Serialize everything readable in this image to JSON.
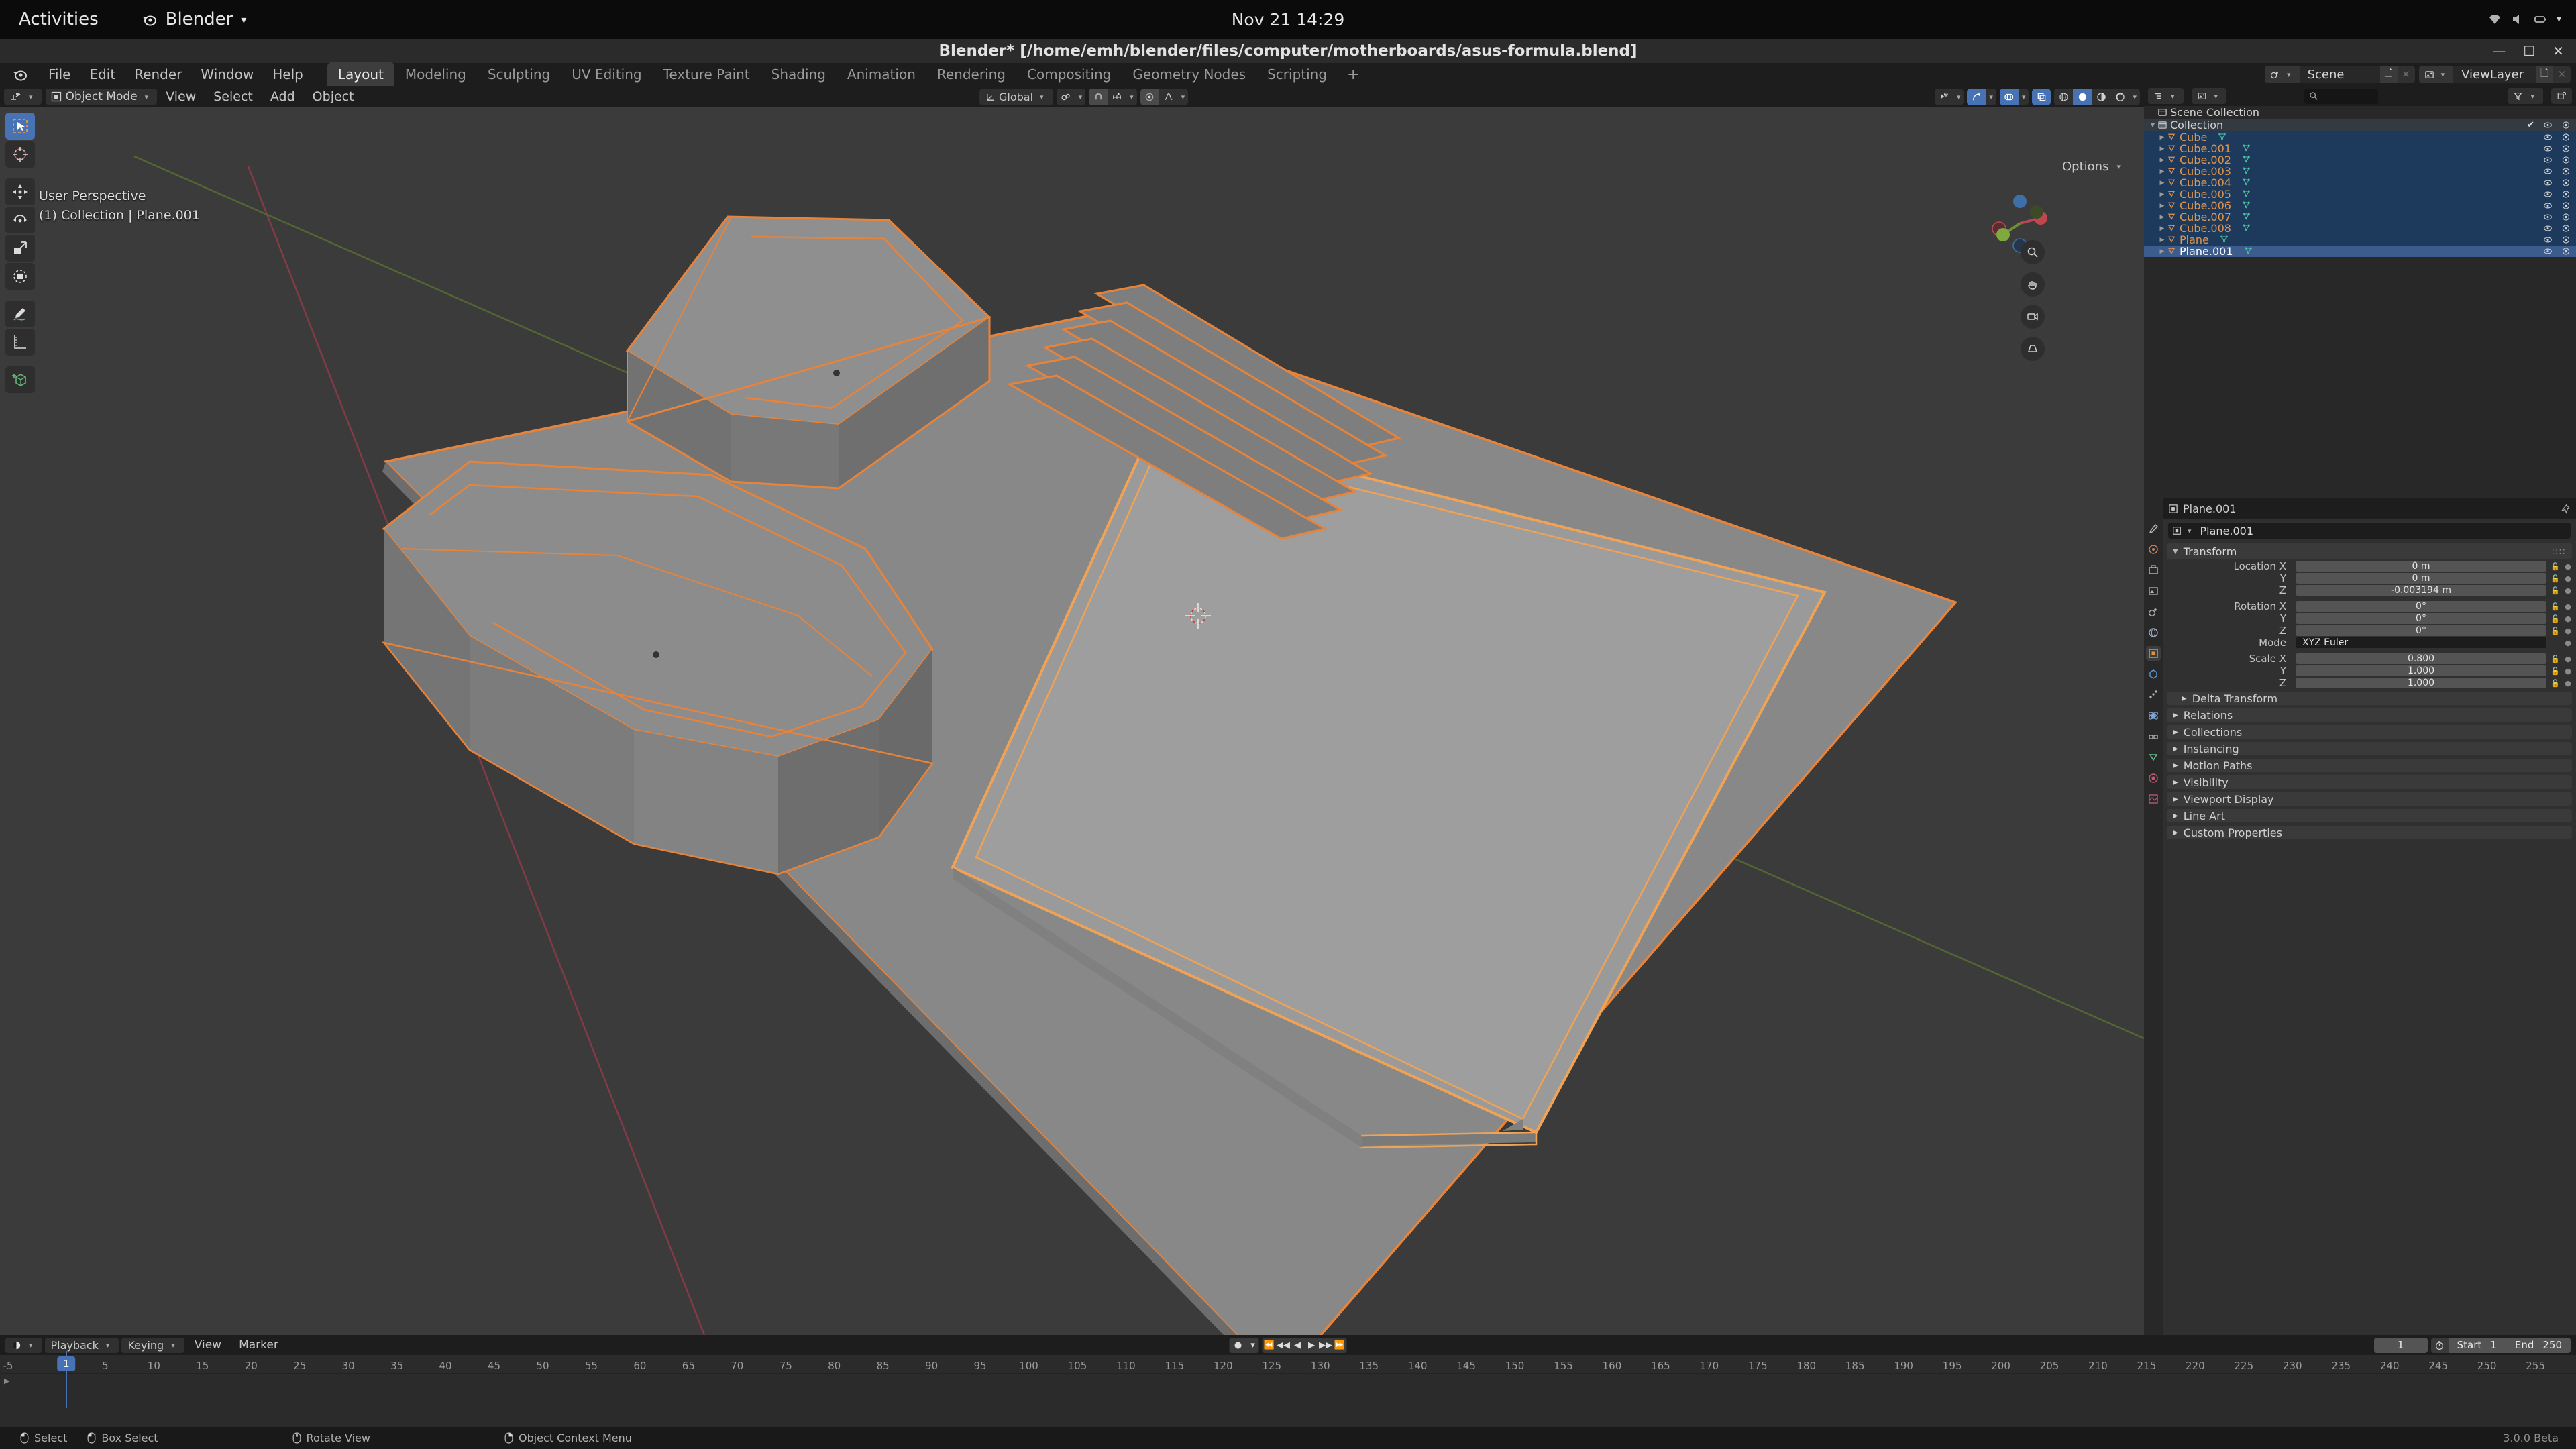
{
  "desktop": {
    "activities": "Activities",
    "app_name": "Blender",
    "clock": "Nov 21  14:29"
  },
  "window": {
    "title": "Blender* [/home/emh/blender/files/computer/motherboards/asus-formula.blend]"
  },
  "topbar": {
    "menus": [
      "File",
      "Edit",
      "Render",
      "Window",
      "Help"
    ],
    "workspaces": [
      {
        "label": "Layout",
        "active": true
      },
      {
        "label": "Modeling",
        "active": false
      },
      {
        "label": "Sculpting",
        "active": false
      },
      {
        "label": "UV Editing",
        "active": false
      },
      {
        "label": "Texture Paint",
        "active": false
      },
      {
        "label": "Shading",
        "active": false
      },
      {
        "label": "Animation",
        "active": false
      },
      {
        "label": "Rendering",
        "active": false
      },
      {
        "label": "Compositing",
        "active": false
      },
      {
        "label": "Geometry Nodes",
        "active": false
      },
      {
        "label": "Scripting",
        "active": false
      }
    ],
    "add_workspace": "+",
    "scene_name": "Scene",
    "viewlayer_name": "ViewLayer"
  },
  "viewport": {
    "mode": "Object Mode",
    "menus": [
      "View",
      "Select",
      "Add",
      "Object"
    ],
    "transform_orientation": "Global",
    "options_label": "Options",
    "overlay_line1": "User Perspective",
    "overlay_line2": "(1) Collection | Plane.001"
  },
  "outliner": {
    "scene_collection": "Scene Collection",
    "collection": "Collection",
    "items": [
      {
        "name": "Cube",
        "selected": true,
        "active": false
      },
      {
        "name": "Cube.001",
        "selected": true,
        "active": false
      },
      {
        "name": "Cube.002",
        "selected": true,
        "active": false
      },
      {
        "name": "Cube.003",
        "selected": true,
        "active": false
      },
      {
        "name": "Cube.004",
        "selected": true,
        "active": false
      },
      {
        "name": "Cube.005",
        "selected": true,
        "active": false
      },
      {
        "name": "Cube.006",
        "selected": true,
        "active": false
      },
      {
        "name": "Cube.007",
        "selected": true,
        "active": false
      },
      {
        "name": "Cube.008",
        "selected": true,
        "active": false
      },
      {
        "name": "Plane",
        "selected": true,
        "active": false
      },
      {
        "name": "Plane.001",
        "selected": true,
        "active": true
      }
    ]
  },
  "properties": {
    "breadcrumb_object": "Plane.001",
    "object_name": "Plane.001",
    "transform_panel": "Transform",
    "fields": [
      {
        "label": "Location X",
        "value": "0 m"
      },
      {
        "label": "Y",
        "value": "0 m"
      },
      {
        "label": "Z",
        "value": "-0.003194 m"
      }
    ],
    "rotation_fields": [
      {
        "label": "Rotation X",
        "value": "0°"
      },
      {
        "label": "Y",
        "value": "0°"
      },
      {
        "label": "Z",
        "value": "0°"
      }
    ],
    "mode_label": "Mode",
    "mode_value": "XYZ Euler",
    "scale_fields": [
      {
        "label": "Scale X",
        "value": "0.800"
      },
      {
        "label": "Y",
        "value": "1.000"
      },
      {
        "label": "Z",
        "value": "1.000"
      }
    ],
    "delta_transform": "Delta Transform",
    "panels": [
      "Relations",
      "Collections",
      "Instancing",
      "Motion Paths",
      "Visibility",
      "Viewport Display",
      "Line Art",
      "Custom Properties"
    ]
  },
  "timeline": {
    "playback": "Playback",
    "keying": "Keying",
    "view": "View",
    "marker": "Marker",
    "current_frame": "1",
    "start_label": "Start",
    "start_value": "1",
    "end_label": "End",
    "end_value": "250",
    "ruler_ticks": [
      "-5",
      "5",
      "10",
      "15",
      "20",
      "25",
      "30",
      "35",
      "40",
      "45",
      "50",
      "55",
      "60",
      "65",
      "70",
      "75",
      "80",
      "85",
      "90",
      "95",
      "100",
      "105",
      "110",
      "115",
      "120",
      "125",
      "130",
      "135",
      "140",
      "145",
      "150",
      "155",
      "160",
      "165",
      "170",
      "175",
      "180",
      "185",
      "190",
      "195",
      "200",
      "205",
      "210",
      "215",
      "220",
      "225",
      "230",
      "235",
      "240",
      "245",
      "250",
      "255"
    ],
    "playhead_label": "1"
  },
  "statusbar": {
    "items": [
      "Select",
      "Box Select",
      "Rotate View",
      "Object Context Menu"
    ],
    "version": "3.0.0 Beta"
  },
  "colors": {
    "accent_blue": "#4772b3",
    "object_orange": "#e0954f",
    "selected_outline": "#ed9b4b",
    "active_outline": "#ffa04d",
    "viewport_bg": "#3b3b3b",
    "axis_x": "#9c3b4a",
    "axis_y": "#5c7a2e"
  }
}
